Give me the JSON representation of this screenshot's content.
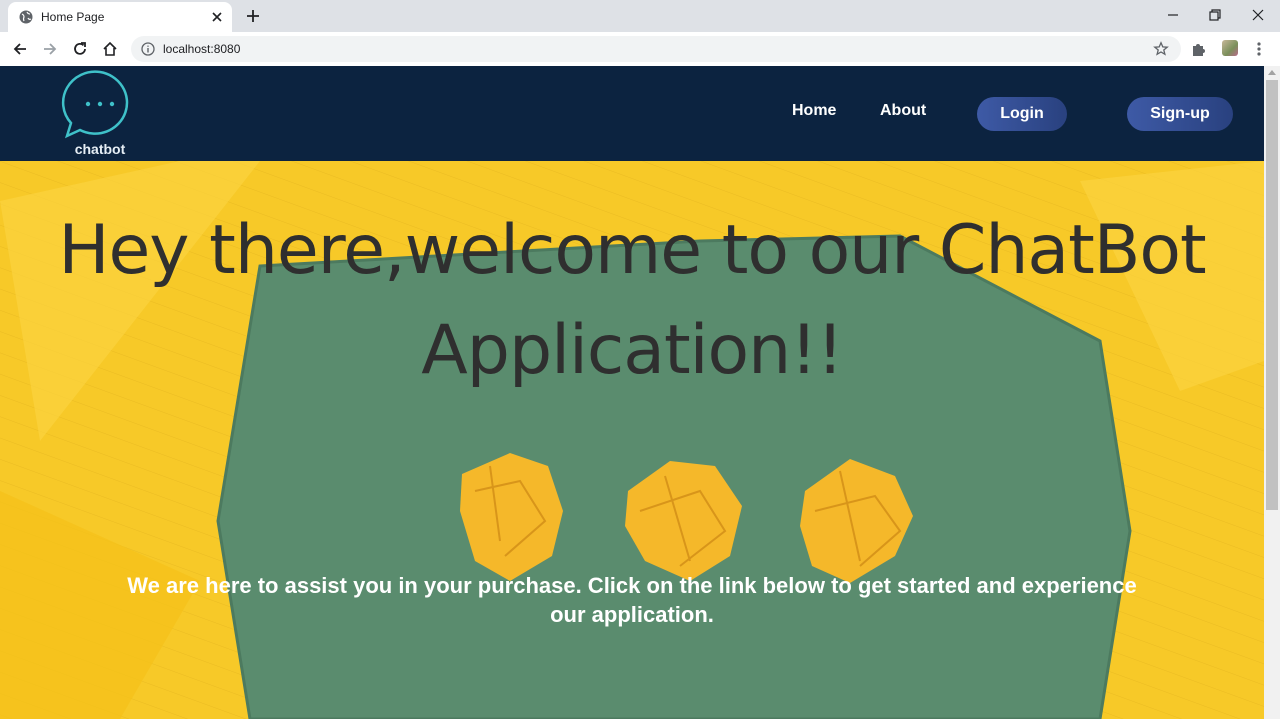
{
  "browser": {
    "tab_title": "Home Page",
    "url": "localhost:8080"
  },
  "site": {
    "logo_text": "chatbot",
    "nav": {
      "home": "Home",
      "about": "About",
      "login": "Login",
      "signup": "Sign-up"
    }
  },
  "hero": {
    "title_line1": "Hey there,welcome to our ChatBot",
    "title_line2": "Application!!",
    "subtitle_line1": "We are here to assist you in your purchase. Click on the link below to get started and experience",
    "subtitle_line2": "our application."
  },
  "colors": {
    "navbar_bg": "#0c2340",
    "button_gradient_start": "#3e5aa6",
    "hero_yellow": "#f7c928",
    "hero_green": "#5a8c6e",
    "logo_teal": "#3fc1c9"
  },
  "icons": {
    "tab": "globe-icon",
    "close": "close-icon",
    "new_tab": "plus-icon",
    "back": "arrow-left-icon",
    "forward": "arrow-right-icon",
    "reload": "reload-icon",
    "home": "home-icon",
    "info": "info-icon",
    "bookmark": "star-icon",
    "extensions": "puzzle-icon",
    "menu": "kebab-icon",
    "logo": "chat-bubble-icon"
  }
}
